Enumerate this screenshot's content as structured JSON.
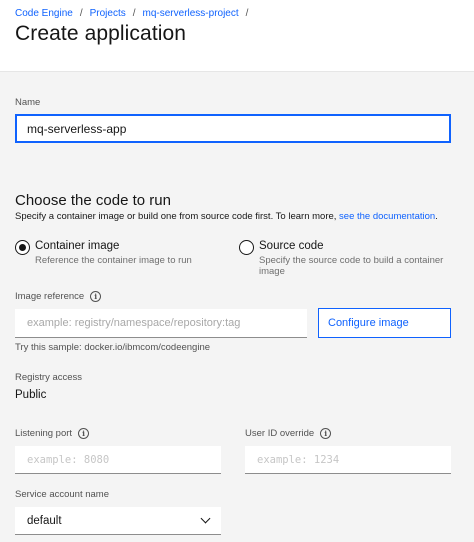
{
  "breadcrumb": {
    "items": [
      "Code Engine",
      "Projects",
      "mq-serverless-project"
    ],
    "separator": "/"
  },
  "page": {
    "title": "Create application"
  },
  "name_field": {
    "label": "Name",
    "value": "mq-serverless-app"
  },
  "code_section": {
    "title": "Choose the code to run",
    "description": "Specify a container image or build one from source code first. To learn more,",
    "doc_link": "see the documentation",
    "description_end": ".",
    "options": [
      {
        "title": "Container image",
        "description": "Reference the container image to run",
        "selected": true
      },
      {
        "title": "Source code",
        "description_line1": "Specify the source code to build a container",
        "description_line2": "image",
        "selected": false
      }
    ]
  },
  "image_reference": {
    "label": "Image reference",
    "placeholder": "example: registry/namespace/repository:tag",
    "configure_button": "Configure image",
    "helper": "Try this sample: docker.io/ibmcom/codeengine"
  },
  "registry_access": {
    "label": "Registry access",
    "value": "Public"
  },
  "listening_port": {
    "label": "Listening port",
    "placeholder": "example: 8080"
  },
  "user_id_override": {
    "label": "User ID override",
    "placeholder": "example: 1234"
  },
  "service_account": {
    "label": "Service account name",
    "selected": "default"
  },
  "icons": {
    "info": "info-icon",
    "chevron": "chevron-down-icon"
  },
  "colors": {
    "link": "#0f62fe",
    "focus_border": "#0f62fe",
    "panel_bg": "#f4f4f4",
    "text": "#161616"
  }
}
